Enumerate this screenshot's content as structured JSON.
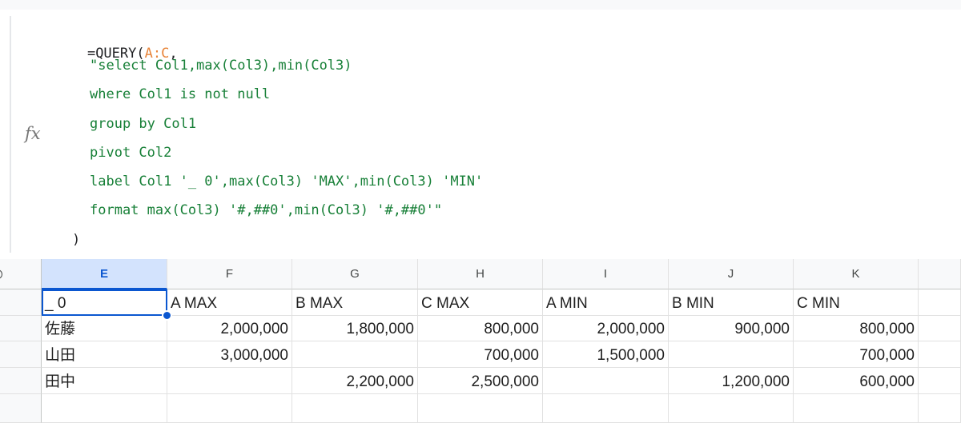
{
  "formula": {
    "fx_label": "fx",
    "line1_prefix": "=QUERY(",
    "line1_range": "A:C",
    "line1_suffix": ",",
    "line2": "\"select Col1,max(Col3),min(Col3)",
    "line3": "where Col1 is not null",
    "line4": "group by Col1",
    "line5": "pivot Col2",
    "line6": "label Col1 '_ 0',max(Col3) 'MAX',min(Col3) 'MIN'",
    "line7": "format max(Col3) '#,##0',min(Col3) '#,##0'\"",
    "line8": ")"
  },
  "columns": [
    "E",
    "F",
    "G",
    "H",
    "I",
    "J",
    "K"
  ],
  "selected_column": "E",
  "rows": [
    [
      "_ 0",
      "A MAX",
      "B MAX",
      "C MAX",
      "A MIN",
      "B MIN",
      "C MIN"
    ],
    [
      "佐藤",
      "2,000,000",
      "1,800,000",
      "800,000",
      "2,000,000",
      "900,000",
      "800,000"
    ],
    [
      "山田",
      "3,000,000",
      "",
      "700,000",
      "1,500,000",
      "",
      "700,000"
    ],
    [
      "田中",
      "",
      "2,200,000",
      "2,500,000",
      "",
      "1,200,000",
      "600,000"
    ],
    [
      "",
      "",
      "",
      "",
      "",
      "",
      ""
    ]
  ],
  "colors": {
    "accent": "#0b57d0",
    "selected_header_bg": "#d3e3fd",
    "formula_range": "#e8853a",
    "formula_string": "#188038"
  }
}
